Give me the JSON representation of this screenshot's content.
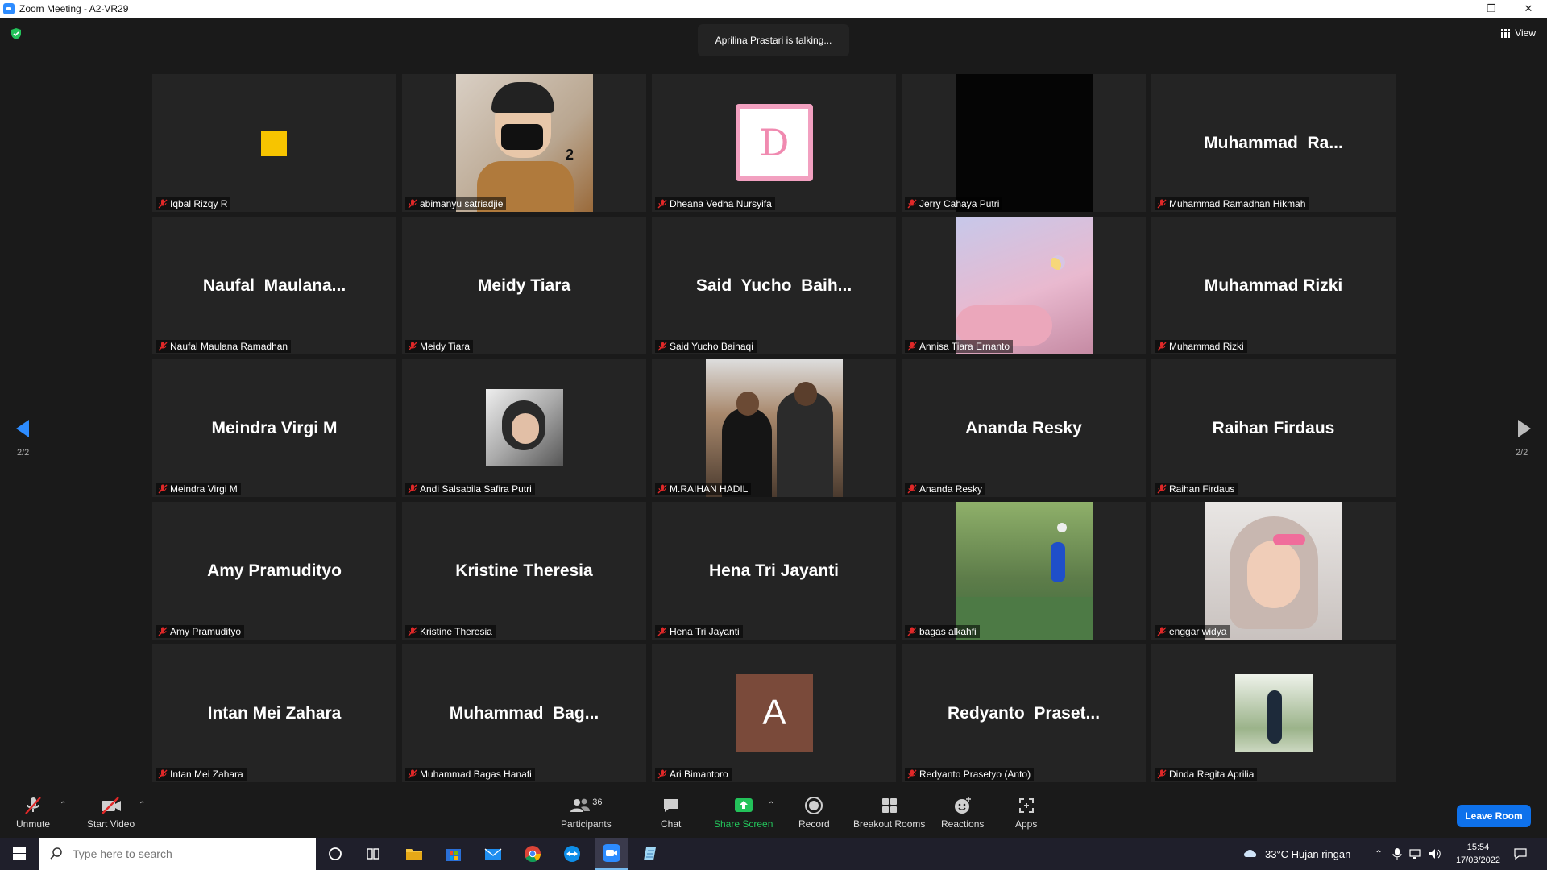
{
  "window": {
    "title": "Zoom Meeting - A2-VR29"
  },
  "meeting": {
    "talking_banner": "Aprilina Prastari is talking...",
    "view_label": "View",
    "page_left": "2/2",
    "page_right": "2/2",
    "tiles": [
      {
        "big": "",
        "label": "Iqbal Rizqy R"
      },
      {
        "big": "",
        "label": "abimanyu satriadjie",
        "photo_text": "2"
      },
      {
        "big": "",
        "label": "Dheana Vedha Nursyifa",
        "photo_text": "D"
      },
      {
        "big": "",
        "label": "Jerry Cahaya Putri"
      },
      {
        "big": "Muhammad  Ra...",
        "label": "Muhammad Ramadhan Hikmah"
      },
      {
        "big": "Naufal  Maulana...",
        "label": "Naufal Maulana Ramadhan"
      },
      {
        "big": "Meidy Tiara",
        "label": "Meidy Tiara"
      },
      {
        "big": "Said  Yucho  Baih...",
        "label": "Said Yucho Baihaqi"
      },
      {
        "big": "",
        "label": "Annisa Tiara Ernanto"
      },
      {
        "big": "Muhammad Rizki",
        "label": "Muhammad Rizki"
      },
      {
        "big": "Meindra Virgi M",
        "label": "Meindra Virgi M"
      },
      {
        "big": "",
        "label": "Andi Salsabila Safira Putri"
      },
      {
        "big": "",
        "label": "M.RAIHAN HADIL"
      },
      {
        "big": "Ananda Resky",
        "label": "Ananda Resky"
      },
      {
        "big": "Raihan Firdaus",
        "label": "Raihan Firdaus"
      },
      {
        "big": "Amy Pramudityo",
        "label": "Amy Pramudityo"
      },
      {
        "big": "Kristine Theresia",
        "label": "Kristine Theresia"
      },
      {
        "big": "Hena Tri Jayanti",
        "label": "Hena Tri Jayanti"
      },
      {
        "big": "",
        "label": "bagas alkahfi"
      },
      {
        "big": "",
        "label": "enggar widya"
      },
      {
        "big": "Intan Mei Zahara",
        "label": "Intan Mei Zahara"
      },
      {
        "big": "Muhammad  Bag...",
        "label": "Muhammad Bagas Hanafi"
      },
      {
        "big": "",
        "label": "Ari Bimantoro",
        "photo_text": "A"
      },
      {
        "big": "Redyanto  Praset...",
        "label": "Redyanto Prasetyo (Anto)"
      },
      {
        "big": "",
        "label": "Dinda Regita Aprilia"
      }
    ]
  },
  "controls": {
    "unmute": "Unmute",
    "start_video": "Start Video",
    "participants": "Participants",
    "participants_count": "36",
    "chat": "Chat",
    "share_screen": "Share Screen",
    "record": "Record",
    "breakout_rooms": "Breakout Rooms",
    "reactions": "Reactions",
    "apps": "Apps",
    "leave": "Leave Room"
  },
  "taskbar": {
    "search_placeholder": "Type here to search",
    "weather": "33°C  Hujan ringan",
    "time": "15:54",
    "date": "17/03/2022"
  },
  "colors": {
    "accent": "#0e71eb",
    "share_green": "#23c25a",
    "muted_red": "#e02828"
  }
}
